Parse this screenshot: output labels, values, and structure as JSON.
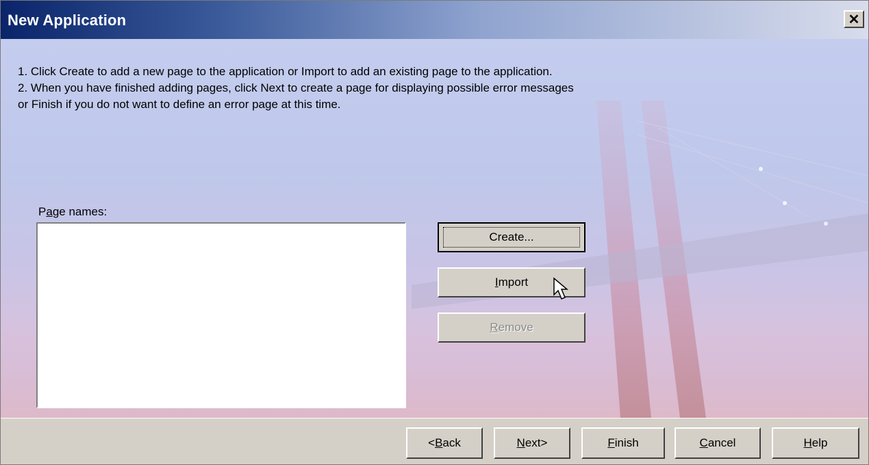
{
  "window": {
    "title": "New Application"
  },
  "instructions": {
    "line1": "1. Click Create to add a new page to the application or Import to add an existing page to the application.",
    "line2": "2. When you have finished adding pages, click Next to create a page for displaying possible error messages",
    "line3": "or Finish if you do not want to define an error page at this time."
  },
  "page_names": {
    "label_pre": "P",
    "label_key": "a",
    "label_post": "ge names:",
    "items": []
  },
  "buttons": {
    "create": {
      "label": "Create..."
    },
    "import": {
      "key": "I",
      "rest": "mport"
    },
    "remove": {
      "key": "R",
      "rest": "emove",
      "disabled": true
    }
  },
  "footer": {
    "back": {
      "pre": "<",
      "key": "B",
      "rest": "ack"
    },
    "next": {
      "pre": "",
      "key": "N",
      "rest": "ext>"
    },
    "finish": {
      "pre": "",
      "key": "F",
      "rest": "inish"
    },
    "cancel": {
      "pre": "",
      "key": "C",
      "rest": "ancel"
    },
    "help": {
      "pre": "",
      "key": "H",
      "rest": "elp"
    }
  },
  "icons": {
    "close": "close-icon",
    "cursor": "arrow-cursor-icon"
  }
}
